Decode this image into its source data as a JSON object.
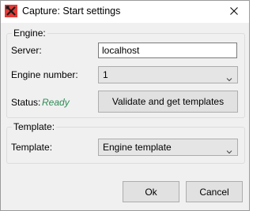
{
  "window": {
    "title": "Capture: Start settings",
    "app_icon": "red-tools-icon",
    "close_icon": "close-icon"
  },
  "engine_group": {
    "legend": "Engine:",
    "server_label": "Server:",
    "server_value": "localhost",
    "engine_number_label": "Engine number:",
    "engine_number_value": "1",
    "status_label": "Status:",
    "status_value": "Ready",
    "status_color": "#2e8b57",
    "validate_button": "Validate and get templates"
  },
  "template_group": {
    "legend": "Template:",
    "template_label": "Template:",
    "template_value": "Engine template"
  },
  "footer": {
    "ok_button": "Ok",
    "cancel_button": "Cancel"
  }
}
